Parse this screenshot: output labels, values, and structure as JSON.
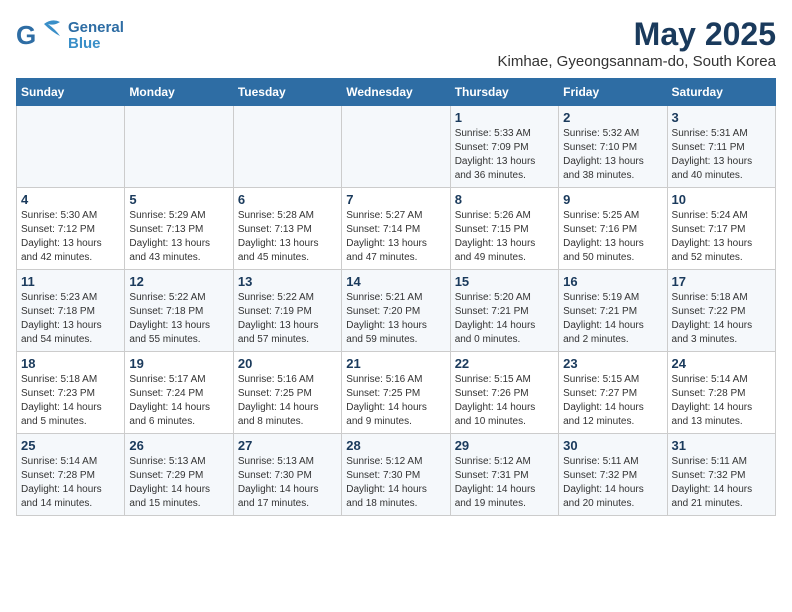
{
  "header": {
    "logo_general": "General",
    "logo_blue": "Blue",
    "title": "May 2025",
    "subtitle": "Kimhae, Gyeongsannam-do, South Korea"
  },
  "days_of_week": [
    "Sunday",
    "Monday",
    "Tuesday",
    "Wednesday",
    "Thursday",
    "Friday",
    "Saturday"
  ],
  "weeks": [
    [
      {
        "day": "",
        "info": ""
      },
      {
        "day": "",
        "info": ""
      },
      {
        "day": "",
        "info": ""
      },
      {
        "day": "",
        "info": ""
      },
      {
        "day": "1",
        "info": "Sunrise: 5:33 AM\nSunset: 7:09 PM\nDaylight: 13 hours\nand 36 minutes."
      },
      {
        "day": "2",
        "info": "Sunrise: 5:32 AM\nSunset: 7:10 PM\nDaylight: 13 hours\nand 38 minutes."
      },
      {
        "day": "3",
        "info": "Sunrise: 5:31 AM\nSunset: 7:11 PM\nDaylight: 13 hours\nand 40 minutes."
      }
    ],
    [
      {
        "day": "4",
        "info": "Sunrise: 5:30 AM\nSunset: 7:12 PM\nDaylight: 13 hours\nand 42 minutes."
      },
      {
        "day": "5",
        "info": "Sunrise: 5:29 AM\nSunset: 7:13 PM\nDaylight: 13 hours\nand 43 minutes."
      },
      {
        "day": "6",
        "info": "Sunrise: 5:28 AM\nSunset: 7:13 PM\nDaylight: 13 hours\nand 45 minutes."
      },
      {
        "day": "7",
        "info": "Sunrise: 5:27 AM\nSunset: 7:14 PM\nDaylight: 13 hours\nand 47 minutes."
      },
      {
        "day": "8",
        "info": "Sunrise: 5:26 AM\nSunset: 7:15 PM\nDaylight: 13 hours\nand 49 minutes."
      },
      {
        "day": "9",
        "info": "Sunrise: 5:25 AM\nSunset: 7:16 PM\nDaylight: 13 hours\nand 50 minutes."
      },
      {
        "day": "10",
        "info": "Sunrise: 5:24 AM\nSunset: 7:17 PM\nDaylight: 13 hours\nand 52 minutes."
      }
    ],
    [
      {
        "day": "11",
        "info": "Sunrise: 5:23 AM\nSunset: 7:18 PM\nDaylight: 13 hours\nand 54 minutes."
      },
      {
        "day": "12",
        "info": "Sunrise: 5:22 AM\nSunset: 7:18 PM\nDaylight: 13 hours\nand 55 minutes."
      },
      {
        "day": "13",
        "info": "Sunrise: 5:22 AM\nSunset: 7:19 PM\nDaylight: 13 hours\nand 57 minutes."
      },
      {
        "day": "14",
        "info": "Sunrise: 5:21 AM\nSunset: 7:20 PM\nDaylight: 13 hours\nand 59 minutes."
      },
      {
        "day": "15",
        "info": "Sunrise: 5:20 AM\nSunset: 7:21 PM\nDaylight: 14 hours\nand 0 minutes."
      },
      {
        "day": "16",
        "info": "Sunrise: 5:19 AM\nSunset: 7:21 PM\nDaylight: 14 hours\nand 2 minutes."
      },
      {
        "day": "17",
        "info": "Sunrise: 5:18 AM\nSunset: 7:22 PM\nDaylight: 14 hours\nand 3 minutes."
      }
    ],
    [
      {
        "day": "18",
        "info": "Sunrise: 5:18 AM\nSunset: 7:23 PM\nDaylight: 14 hours\nand 5 minutes."
      },
      {
        "day": "19",
        "info": "Sunrise: 5:17 AM\nSunset: 7:24 PM\nDaylight: 14 hours\nand 6 minutes."
      },
      {
        "day": "20",
        "info": "Sunrise: 5:16 AM\nSunset: 7:25 PM\nDaylight: 14 hours\nand 8 minutes."
      },
      {
        "day": "21",
        "info": "Sunrise: 5:16 AM\nSunset: 7:25 PM\nDaylight: 14 hours\nand 9 minutes."
      },
      {
        "day": "22",
        "info": "Sunrise: 5:15 AM\nSunset: 7:26 PM\nDaylight: 14 hours\nand 10 minutes."
      },
      {
        "day": "23",
        "info": "Sunrise: 5:15 AM\nSunset: 7:27 PM\nDaylight: 14 hours\nand 12 minutes."
      },
      {
        "day": "24",
        "info": "Sunrise: 5:14 AM\nSunset: 7:28 PM\nDaylight: 14 hours\nand 13 minutes."
      }
    ],
    [
      {
        "day": "25",
        "info": "Sunrise: 5:14 AM\nSunset: 7:28 PM\nDaylight: 14 hours\nand 14 minutes."
      },
      {
        "day": "26",
        "info": "Sunrise: 5:13 AM\nSunset: 7:29 PM\nDaylight: 14 hours\nand 15 minutes."
      },
      {
        "day": "27",
        "info": "Sunrise: 5:13 AM\nSunset: 7:30 PM\nDaylight: 14 hours\nand 17 minutes."
      },
      {
        "day": "28",
        "info": "Sunrise: 5:12 AM\nSunset: 7:30 PM\nDaylight: 14 hours\nand 18 minutes."
      },
      {
        "day": "29",
        "info": "Sunrise: 5:12 AM\nSunset: 7:31 PM\nDaylight: 14 hours\nand 19 minutes."
      },
      {
        "day": "30",
        "info": "Sunrise: 5:11 AM\nSunset: 7:32 PM\nDaylight: 14 hours\nand 20 minutes."
      },
      {
        "day": "31",
        "info": "Sunrise: 5:11 AM\nSunset: 7:32 PM\nDaylight: 14 hours\nand 21 minutes."
      }
    ]
  ]
}
